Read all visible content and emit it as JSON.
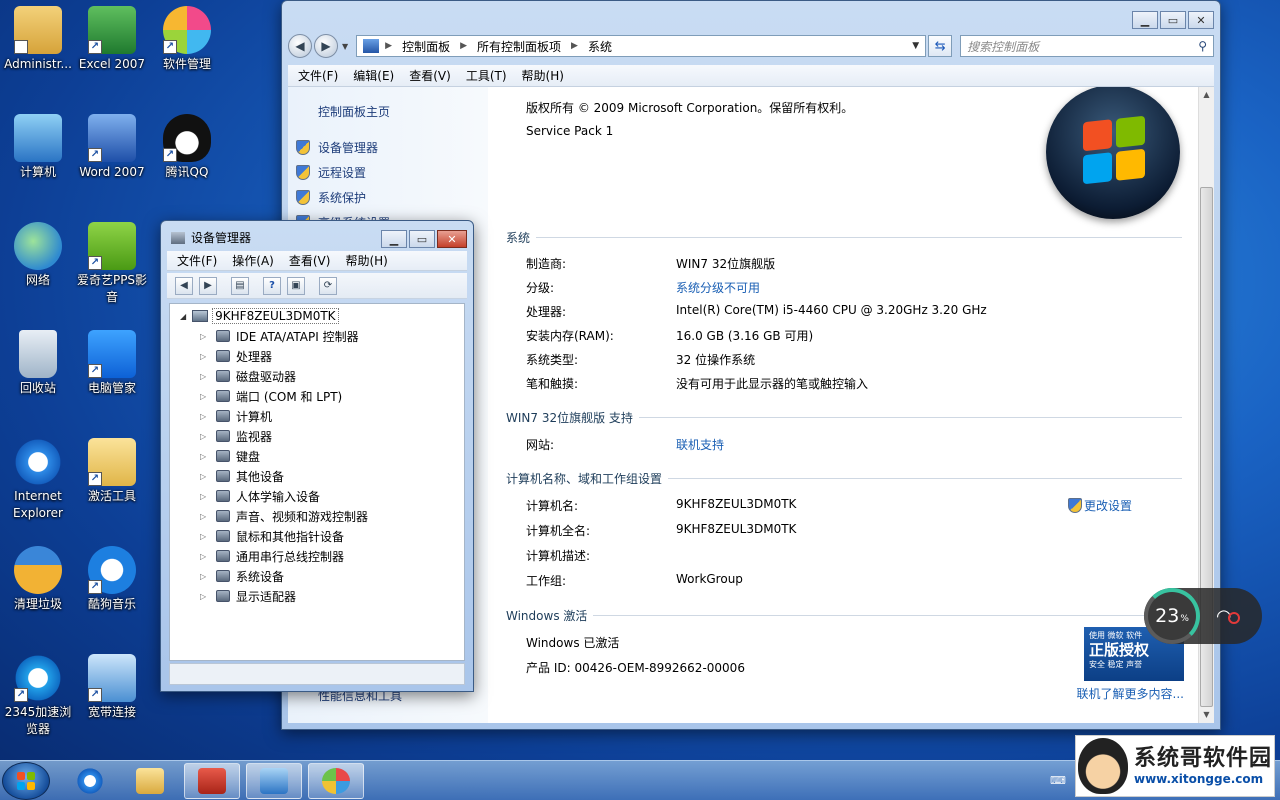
{
  "desktop": {
    "icons": [
      {
        "label": "Administr..."
      },
      {
        "label": "Excel 2007"
      },
      {
        "label": "软件管理"
      },
      {
        "label": "计算机"
      },
      {
        "label": "Word 2007"
      },
      {
        "label": "腾讯QQ"
      },
      {
        "label": "网络"
      },
      {
        "label": "爱奇艺PPS影音"
      },
      {
        "label": "回收站"
      },
      {
        "label": "电脑管家"
      },
      {
        "label": "Internet Explorer"
      },
      {
        "label": "激活工具"
      },
      {
        "label": "清理垃圾"
      },
      {
        "label": "酷狗音乐"
      },
      {
        "label": "2345加速浏览器"
      },
      {
        "label": "宽带连接"
      }
    ]
  },
  "control_panel": {
    "breadcrumb": [
      "控制面板",
      "所有控制面板项",
      "系统"
    ],
    "search_placeholder": "搜索控制面板",
    "menu": [
      "文件(F)",
      "编辑(E)",
      "查看(V)",
      "工具(T)",
      "帮助(H)"
    ],
    "left": {
      "home": "控制面板主页",
      "tasks": [
        "设备管理器",
        "远程设置",
        "系统保护",
        "高级系统设置"
      ],
      "see_also": "性能信息和工具"
    },
    "copyright": "版权所有 © 2009 Microsoft Corporation。保留所有权利。",
    "service_pack": "Service Pack 1",
    "system_section": {
      "header": "系统",
      "rows": [
        {
          "label": "制造商:",
          "value": "WIN7 32位旗舰版"
        },
        {
          "label": "分级:",
          "value": "系统分级不可用"
        },
        {
          "label": "处理器:",
          "value": "Intel(R) Core(TM) i5-4460  CPU @ 3.20GHz   3.20 GHz"
        },
        {
          "label": "安装内存(RAM):",
          "value": "16.0 GB (3.16 GB 可用)"
        },
        {
          "label": "系统类型:",
          "value": "32 位操作系统"
        },
        {
          "label": "笔和触摸:",
          "value": "没有可用于此显示器的笔或触控输入"
        }
      ]
    },
    "support_section": {
      "header": "WIN7 32位旗舰版 支持",
      "label": "网站:",
      "value": "联机支持"
    },
    "computer_section": {
      "header": "计算机名称、域和工作组设置",
      "change_settings": "更改设置",
      "rows": [
        {
          "label": "计算机名:",
          "value": "9KHF8ZEUL3DM0TK"
        },
        {
          "label": "计算机全名:",
          "value": "9KHF8ZEUL3DM0TK"
        },
        {
          "label": "计算机描述:",
          "value": ""
        },
        {
          "label": "工作组:",
          "value": "WorkGroup"
        }
      ]
    },
    "activation_section": {
      "header": "Windows 激活",
      "status": "Windows 已激活",
      "product_id": "产品 ID: 00426-OEM-8992662-00006",
      "learn_more": "联机了解更多内容...",
      "genuine": {
        "line1": "使用 微软 软件",
        "line2": "正版授权",
        "line3": "安全 稳定 声誉"
      }
    }
  },
  "device_manager": {
    "title": "设备管理器",
    "menu": [
      "文件(F)",
      "操作(A)",
      "查看(V)",
      "帮助(H)"
    ],
    "root": "9KHF8ZEUL3DM0TK",
    "items": [
      "IDE ATA/ATAPI 控制器",
      "处理器",
      "磁盘驱动器",
      "端口 (COM 和 LPT)",
      "计算机",
      "监视器",
      "键盘",
      "其他设备",
      "人体学输入设备",
      "声音、视频和游戏控制器",
      "鼠标和其他指针设备",
      "通用串行总线控制器",
      "系统设备",
      "显示适配器"
    ]
  },
  "speed_widget": {
    "percent": "23",
    "unit": "%"
  },
  "brand": {
    "name": "系统哥软件园",
    "url": "www.xitongge.com"
  },
  "colors": {
    "accent": "#1a5fb4",
    "taskbar": "#5d8fc9"
  }
}
